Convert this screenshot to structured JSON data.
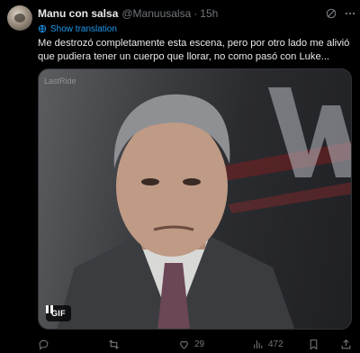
{
  "tweet": {
    "display_name": "Manu con salsa",
    "handle": "@Manuusalsa",
    "separator": "·",
    "time": "15h",
    "show_translation": "Show translation",
    "text": "Me destrozó completamente esta escena, pero por otro lado me alivió que pudiera tener un cuerpo que llorar, no como pasó con Luke...",
    "media": {
      "watermark": "LastRide",
      "badge": "GIF"
    },
    "actions": {
      "reply_count": "",
      "repost_count": "",
      "like_count": "29",
      "views_count": "472"
    }
  },
  "icons": {
    "grok": "grok-icon",
    "more": "more-icon",
    "translate": "globe-icon",
    "reply": "reply-icon",
    "repost": "repost-icon",
    "like": "heart-icon",
    "views": "views-icon",
    "share": "share-icon",
    "pause": "pause-icon"
  },
  "colors": {
    "background": "#000000",
    "text": "#e7e9ea",
    "muted": "#71767b",
    "link": "#1d9bf0"
  }
}
